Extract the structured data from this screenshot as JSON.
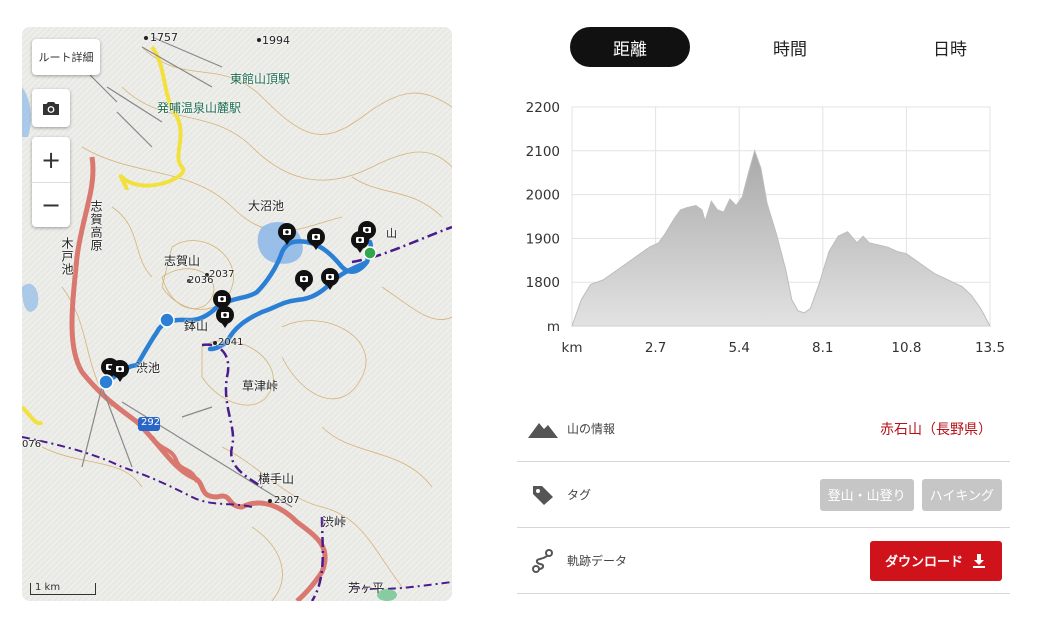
{
  "map": {
    "route_detail_label": "ルート詳細",
    "zoom_in": "+",
    "zoom_out": "−",
    "scale_label": "1 km",
    "labels": {
      "higashidate_station": "東館山頂駅",
      "hatsuho_station": "発哺温泉山麓駅",
      "onuma_pond": "大沼池",
      "shiga_yama": "志賀山",
      "hachi_yama": "鉢山",
      "shibu_pond": "渋池",
      "kusatsu_pass": "草津峠",
      "yokote_yama": "横手山",
      "shibu_pass": "渋峠",
      "yoshigadaira": "芳ヶ平",
      "shiga_kogen": "志賀高原",
      "kido_pond": "木戸池",
      "yama_suffix": "山",
      "elev_1757": "1757",
      "elev_1994": "1994",
      "elev_2037": "2037",
      "elev_2036": "2036",
      "elev_2041": "2041",
      "elev_2307": "2307",
      "route_292": "292",
      "elev_076": "076"
    }
  },
  "tabs": [
    "距離",
    "時間",
    "日時"
  ],
  "active_tab": 0,
  "chart_data": {
    "type": "area",
    "x_unit": "km",
    "y_unit": "m",
    "xlim": [
      0,
      13.5
    ],
    "ylim": [
      1700,
      2200
    ],
    "x_ticks": [
      "2.7",
      "5.4",
      "8.1",
      "10.8",
      "13.5"
    ],
    "y_ticks": [
      "1800",
      "1900",
      "2000",
      "2100",
      "2200"
    ],
    "x": [
      0,
      0.3,
      0.6,
      1.0,
      1.5,
      2.0,
      2.5,
      2.8,
      3.0,
      3.3,
      3.5,
      3.7,
      4.0,
      4.2,
      4.3,
      4.5,
      4.7,
      4.9,
      5.1,
      5.3,
      5.5,
      5.7,
      5.9,
      6.1,
      6.3,
      6.6,
      6.9,
      7.1,
      7.3,
      7.5,
      7.7,
      8.0,
      8.3,
      8.6,
      8.9,
      9.2,
      9.4,
      9.6,
      9.9,
      10.2,
      10.5,
      10.8,
      11.1,
      11.4,
      11.7,
      12.0,
      12.3,
      12.6,
      12.9,
      13.2,
      13.5
    ],
    "y": [
      1700,
      1760,
      1795,
      1805,
      1830,
      1855,
      1880,
      1890,
      1910,
      1945,
      1965,
      1970,
      1975,
      1965,
      1940,
      1985,
      1965,
      1960,
      1990,
      1975,
      1995,
      2050,
      2100,
      2060,
      1980,
      1910,
      1830,
      1760,
      1735,
      1730,
      1740,
      1800,
      1870,
      1905,
      1915,
      1890,
      1905,
      1890,
      1885,
      1880,
      1870,
      1865,
      1850,
      1835,
      1820,
      1810,
      1800,
      1790,
      1770,
      1740,
      1700
    ]
  },
  "info": {
    "mountain_label": "山の情報",
    "mountain_value": "赤石山（長野県）",
    "tag_label": "タグ",
    "tags": [
      "登山・山登り",
      "ハイキング"
    ],
    "track_label": "軌跡データ",
    "download_label": "ダウンロード"
  },
  "colors": {
    "route": "#2b7fd4",
    "download_button": "#d0121b",
    "mountain_value": "#b5121b",
    "tag_bg": "#c6c6c6",
    "area_fill": "#c9c9c9"
  }
}
